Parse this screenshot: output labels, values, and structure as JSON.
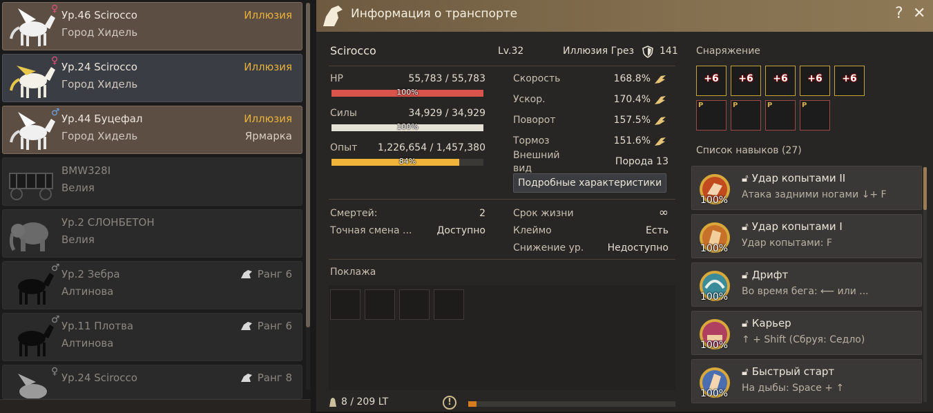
{
  "mount_list": [
    {
      "name": "Ур.46 Scirocco",
      "location": "Город Хидель",
      "type": "Иллюзия",
      "mark": "",
      "gender": "♀",
      "rank": "",
      "style": "colored"
    },
    {
      "name": "Ур.24 Scirocco",
      "location": "Город Хидель",
      "type": "Иллюзия",
      "mark": "",
      "gender": "♀",
      "rank": "",
      "style": "blue"
    },
    {
      "name": "Ур.44 Буцефал",
      "location": "Город Хидель",
      "type": "Иллюзия",
      "mark": "Ярмарка",
      "gender": "♂",
      "rank": "",
      "style": "colored"
    },
    {
      "name": "BMW328I",
      "location": "Велия",
      "type": "",
      "mark": "",
      "gender": "",
      "rank": "",
      "style": "plain"
    },
    {
      "name": "Ур.2 СЛОНБЕТОН",
      "location": "Велия",
      "type": "",
      "mark": "",
      "gender": "",
      "rank": "",
      "style": "plain"
    },
    {
      "name": "Ур.2 Зебра",
      "location": "Алтинова",
      "type": "",
      "mark": "",
      "gender": "♂",
      "rank": "Ранг 6",
      "style": "plain"
    },
    {
      "name": "Ур.11 Плотва",
      "location": "Алтинова",
      "type": "",
      "mark": "",
      "gender": "♂",
      "rank": "Ранг 6",
      "style": "plain"
    },
    {
      "name": "Ур.24 Scirocco",
      "location": "",
      "type": "",
      "mark": "",
      "gender": "♀",
      "rank": "Ранг 8",
      "style": "plain"
    }
  ],
  "window": {
    "title": "Информация о транспорте",
    "help_label": "?",
    "close_label": "✕"
  },
  "mount": {
    "name": "Scirocco",
    "level": "Lv.32",
    "tier_name": "Иллюзия Грез",
    "defense": "141"
  },
  "stats": {
    "hp_label": "HP",
    "hp_value": "55,783 / 55,783",
    "hp_pct": "100%",
    "hp_fraction": 1.0,
    "stamina_label": "Силы",
    "stamina_value": "34,929 / 34,929",
    "stamina_pct": "100%",
    "stamina_fraction": 1.0,
    "exp_label": "Опыт",
    "exp_value": "1,226,654 / 1,457,380",
    "exp_pct": "84%",
    "exp_fraction": 0.84,
    "speed_label": "Скорость",
    "speed_value": "168.8%",
    "accel_label": "Ускор.",
    "accel_value": "170.4%",
    "turn_label": "Поворот",
    "turn_value": "157.5%",
    "brake_label": "Тормоз",
    "brake_value": "151.6%",
    "look_label": "Внешний вид",
    "look_value": "Порода 13",
    "detail_button": "Подробные характеристики"
  },
  "misc": {
    "deaths_label": "Смертей:",
    "deaths_value": "2",
    "precise_label": "Точная смена ...",
    "precise_value": "Доступно",
    "life_label": "Срок жизни",
    "life_value": "∞",
    "brand_label": "Клеймо",
    "brand_value": "Есть",
    "lvldown_label": "Снижение ур.",
    "lvldown_value": "Недоступно"
  },
  "cargo": {
    "label": "Поклажа",
    "weight": "8 / 209 LT",
    "weight_fraction": 0.04,
    "warning_icon": "!"
  },
  "equipment": {
    "label": "Снаряжение",
    "row1": [
      "+6",
      "+6",
      "+6",
      "+6",
      "+6"
    ],
    "row2": [
      "P",
      "P",
      "P",
      "P"
    ]
  },
  "skills": {
    "header": "Список навыков (27)",
    "items": [
      {
        "name": "Удар копытами II",
        "desc": "Атака задними ногами ↓+ F",
        "pct": "100%",
        "color": "#c24a1f"
      },
      {
        "name": "Удар копытами I",
        "desc": "Удар копытами: F",
        "pct": "100%",
        "color": "#c7702a"
      },
      {
        "name": "Дрифт",
        "desc": "Во время бега: ⟵ или ...",
        "pct": "100%",
        "color": "#3a8c9a"
      },
      {
        "name": "Карьер",
        "desc": "↑ + Shift (Сбруя: Седло)",
        "pct": "100%",
        "color": "#b04060"
      },
      {
        "name": "Быстрый старт",
        "desc": "На дыбы: Space + ↑",
        "pct": "100%",
        "color": "#4a6eb0"
      }
    ]
  },
  "colors": {
    "accent_gold": "#e8b23a",
    "hp_bar": "#d9544a",
    "stamina_bar": "#e7e2d6",
    "exp_bar": "#f0b43a",
    "weight_bar": "#d77d1d"
  }
}
